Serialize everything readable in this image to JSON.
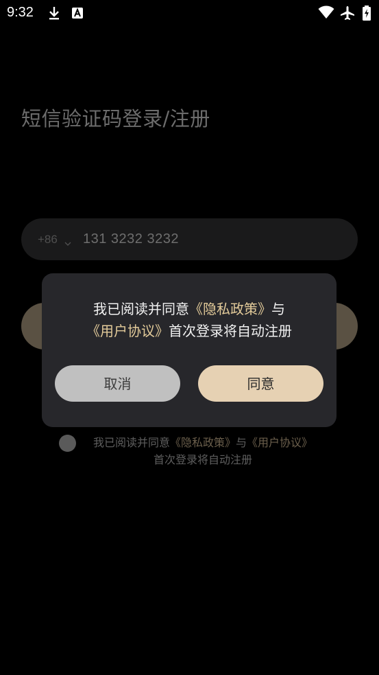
{
  "status_bar": {
    "time": "9:32",
    "icons": [
      "download-icon",
      "a-icon",
      "wifi-icon",
      "airplane-icon",
      "battery-icon"
    ]
  },
  "page": {
    "title": "短信验证码登录/注册",
    "phone": {
      "country_code": "+86",
      "number": "131 3232 3232"
    },
    "agreement": {
      "prefix": "我已阅读并同意",
      "privacy_link": "《隐私政策》",
      "and": "与",
      "user_link": "《用户协议》",
      "suffix": "首次登录将自动注册"
    }
  },
  "dialog": {
    "prefix": "我已阅读并同意",
    "privacy_link": "《隐私政策》",
    "and": "与",
    "user_link": "《用户协议》",
    "suffix": "首次登录将自动注册",
    "cancel_label": "取消",
    "confirm_label": "同意"
  },
  "colors": {
    "background": "#000000",
    "dialog": "#27272b",
    "accent_link": "#e3cb9a",
    "confirm_button": "#e6d1b3",
    "cancel_button": "#c0c0c0"
  }
}
